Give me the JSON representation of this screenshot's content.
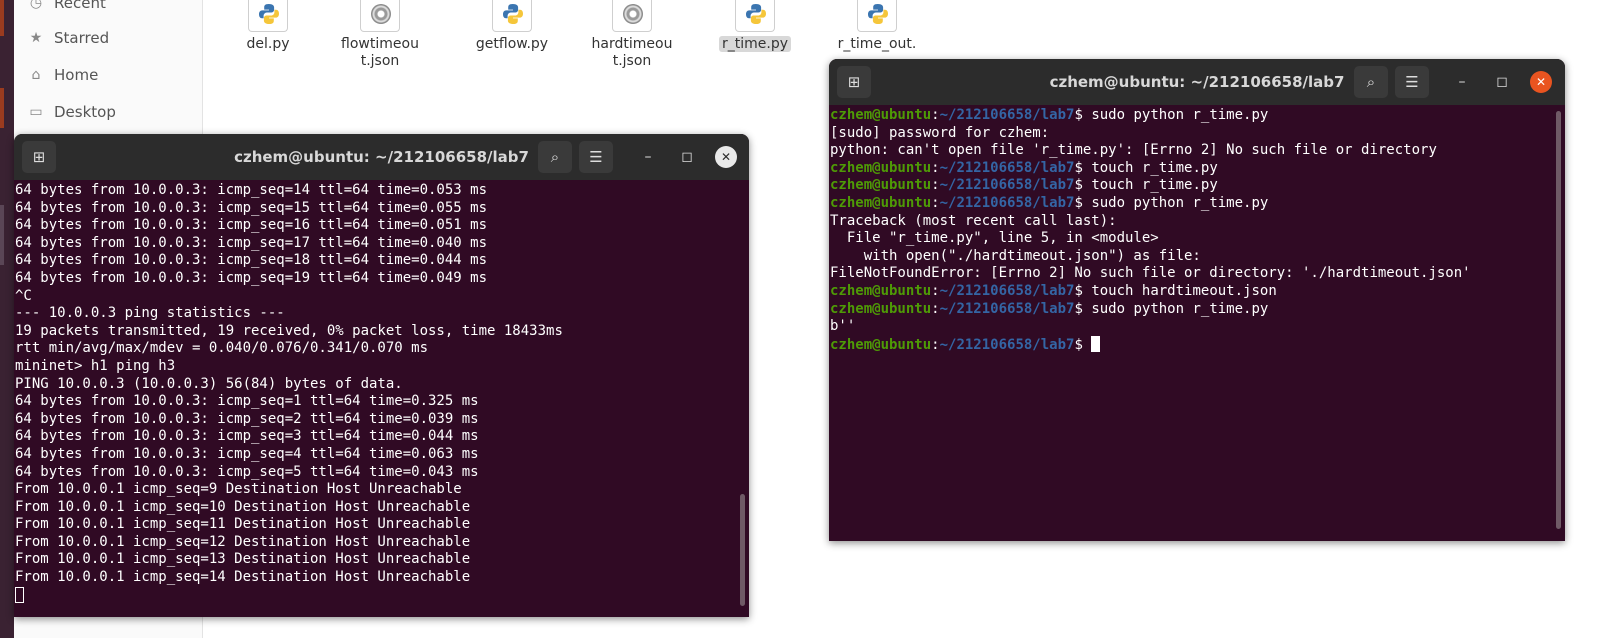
{
  "sidebar": {
    "items": [
      {
        "label": "Recent",
        "icon": "clock-icon"
      },
      {
        "label": "Starred",
        "icon": "star-icon"
      },
      {
        "label": "Home",
        "icon": "home-icon"
      },
      {
        "label": "Desktop",
        "icon": "desktop-icon"
      }
    ]
  },
  "files": [
    {
      "name": "del.py",
      "type": "python"
    },
    {
      "name": "flowtimeou\nt.json",
      "type": "json"
    },
    {
      "name": "getflow.py",
      "type": "python"
    },
    {
      "name": "hardtimeou\nt.json",
      "type": "json"
    },
    {
      "name": "r_time.py",
      "type": "python",
      "selected": true
    },
    {
      "name": "r_time_out.",
      "type": "python"
    }
  ],
  "terminal_left": {
    "title": "czhem@ubuntu: ~/212106658/lab7",
    "lines": [
      "64 bytes from 10.0.0.3: icmp_seq=14 ttl=64 time=0.053 ms",
      "64 bytes from 10.0.0.3: icmp_seq=15 ttl=64 time=0.055 ms",
      "64 bytes from 10.0.0.3: icmp_seq=16 ttl=64 time=0.051 ms",
      "64 bytes from 10.0.0.3: icmp_seq=17 ttl=64 time=0.040 ms",
      "64 bytes from 10.0.0.3: icmp_seq=18 ttl=64 time=0.044 ms",
      "64 bytes from 10.0.0.3: icmp_seq=19 ttl=64 time=0.049 ms",
      "^C",
      "--- 10.0.0.3 ping statistics ---",
      "19 packets transmitted, 19 received, 0% packet loss, time 18433ms",
      "rtt min/avg/max/mdev = 0.040/0.076/0.341/0.070 ms",
      "mininet> h1 ping h3",
      "PING 10.0.0.3 (10.0.0.3) 56(84) bytes of data.",
      "64 bytes from 10.0.0.3: icmp_seq=1 ttl=64 time=0.325 ms",
      "64 bytes from 10.0.0.3: icmp_seq=2 ttl=64 time=0.039 ms",
      "64 bytes from 10.0.0.3: icmp_seq=3 ttl=64 time=0.044 ms",
      "64 bytes from 10.0.0.3: icmp_seq=4 ttl=64 time=0.063 ms",
      "64 bytes from 10.0.0.3: icmp_seq=5 ttl=64 time=0.043 ms",
      "From 10.0.0.1 icmp_seq=9 Destination Host Unreachable",
      "From 10.0.0.1 icmp_seq=10 Destination Host Unreachable",
      "From 10.0.0.1 icmp_seq=11 Destination Host Unreachable",
      "From 10.0.0.1 icmp_seq=12 Destination Host Unreachable",
      "From 10.0.0.1 icmp_seq=13 Destination Host Unreachable",
      "From 10.0.0.1 icmp_seq=14 Destination Host Unreachable"
    ]
  },
  "terminal_right": {
    "title": "czhem@ubuntu: ~/212106658/lab7",
    "prompt_user": "czhem@ubuntu",
    "prompt_path": "~/212106658/lab7",
    "lines": [
      {
        "cmd": "sudo python r_time.py"
      },
      {
        "text": "[sudo] password for czhem:"
      },
      {
        "text": "python: can't open file 'r_time.py': [Errno 2] No such file or directory"
      },
      {
        "cmd": "touch r_time.py"
      },
      {
        "cmd": "touch r_time.py"
      },
      {
        "cmd": "sudo python r_time.py"
      },
      {
        "text": "Traceback (most recent call last):"
      },
      {
        "text": "  File \"r_time.py\", line 5, in <module>"
      },
      {
        "text": "    with open(\"./hardtimeout.json\") as file:"
      },
      {
        "text": "FileNotFoundError: [Errno 2] No such file or directory: './hardtimeout.json'"
      },
      {
        "cmd": "touch hardtimeout.json"
      },
      {
        "cmd": "sudo python r_time.py"
      },
      {
        "text": "b''"
      },
      {
        "cmd": "",
        "cursor": true
      }
    ]
  },
  "icons": {
    "new_tab": "new-tab-icon",
    "search": "search-icon",
    "menu": "hamburger-menu-icon",
    "minimize": "minimize-icon",
    "maximize": "maximize-icon",
    "close": "close-icon"
  },
  "colors": {
    "terminal_bg": "#300a24",
    "titlebar": "#2c2c2c",
    "prompt_user": "#4e9a06",
    "prompt_path": "#3465a4",
    "close_active": "#e95420"
  }
}
